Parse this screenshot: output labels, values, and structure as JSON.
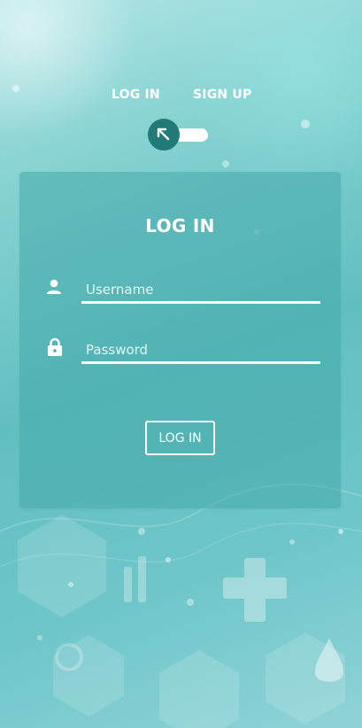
{
  "toggle": {
    "login_label": "LOG IN",
    "signup_label": "SIGN UP"
  },
  "form": {
    "title": "LOG IN",
    "username_placeholder": "Username",
    "password_placeholder": "Password",
    "submit_label": "LOG IN"
  },
  "colors": {
    "accent": "#1f7a78",
    "text": "#ffffff",
    "background": "#62bfc0"
  },
  "icons": {
    "toggle_knob": "arrow-up-left-icon",
    "username": "user-icon",
    "password": "lock-icon"
  }
}
